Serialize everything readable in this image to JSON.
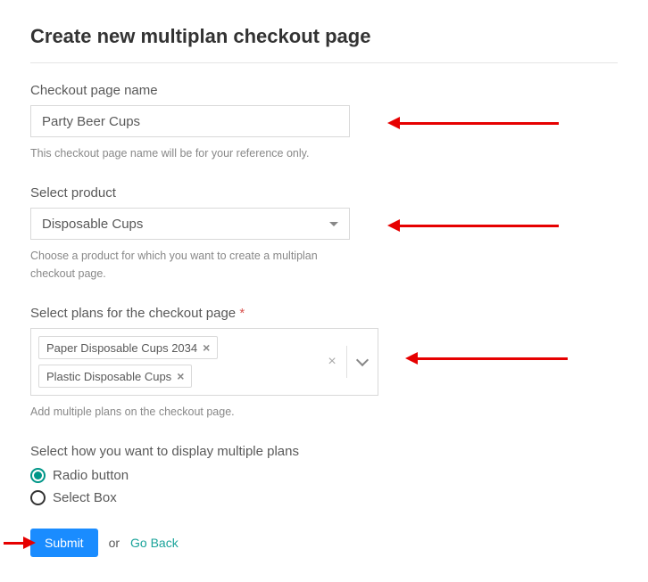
{
  "title": "Create new multiplan checkout page",
  "fields": {
    "name": {
      "label": "Checkout page name",
      "value": "Party Beer Cups",
      "helper": "This checkout page name will be for your reference only."
    },
    "product": {
      "label": "Select product",
      "value": "Disposable Cups",
      "helper": "Choose a product for which you want to create a multiplan checkout page."
    },
    "plans": {
      "label": "Select plans for the checkout page",
      "required_mark": "*",
      "tags": [
        "Paper Disposable Cups 2034",
        "Plastic Disposable Cups"
      ],
      "helper": "Add multiple plans on the checkout page."
    },
    "display": {
      "label": "Select how you want to display multiple plans",
      "options": [
        {
          "label": "Radio button",
          "selected": true
        },
        {
          "label": "Select Box",
          "selected": false
        }
      ]
    }
  },
  "actions": {
    "submit": "Submit",
    "or": "or",
    "back": "Go Back"
  },
  "tag_remove": "×",
  "multi_clear": "×"
}
